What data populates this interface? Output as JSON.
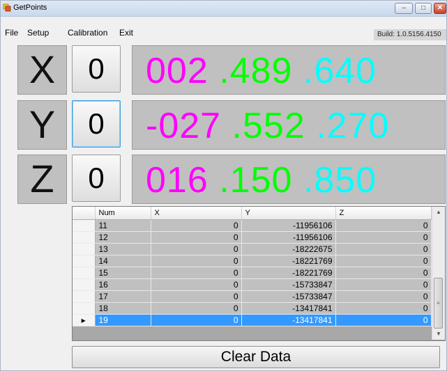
{
  "window": {
    "title": "GetPoints",
    "controls": {
      "minimize": "‒",
      "maximize": "□",
      "close": "✕"
    }
  },
  "menu": {
    "items": [
      "File",
      "Setup",
      "Calibration",
      "Exit"
    ]
  },
  "build_label": "Build: 1.0.5156.4150",
  "axes": [
    {
      "label": "X",
      "zero_button": "0",
      "readout": {
        "int": "002",
        "frac1": ".489",
        "frac2": ".640"
      }
    },
    {
      "label": "Y",
      "zero_button": "0",
      "readout": {
        "int": "-027",
        "frac1": ".552",
        "frac2": ".270"
      }
    },
    {
      "label": "Z",
      "zero_button": "0",
      "readout": {
        "int": "016",
        "frac1": ".150",
        "frac2": ".850"
      }
    }
  ],
  "readout_colors": {
    "integer": "#ff00ff",
    "fraction1": "#00ff00",
    "fraction2": "#00ffff"
  },
  "grid": {
    "columns": [
      "Num",
      "X",
      "Y",
      "Z"
    ],
    "selected_row_index": 8,
    "current_row_marker": "▶",
    "rows": [
      [
        "11",
        "0",
        "-11956106",
        "0"
      ],
      [
        "12",
        "0",
        "-11956106",
        "0"
      ],
      [
        "13",
        "0",
        "-18222675",
        "0"
      ],
      [
        "14",
        "0",
        "-18221769",
        "0"
      ],
      [
        "15",
        "0",
        "-18221769",
        "0"
      ],
      [
        "16",
        "0",
        "-15733847",
        "0"
      ],
      [
        "17",
        "0",
        "-15733847",
        "0"
      ],
      [
        "18",
        "0",
        "-13417841",
        "0"
      ],
      [
        "19",
        "0",
        "-13417841",
        "0"
      ]
    ]
  },
  "clear_button": "Clear Data"
}
